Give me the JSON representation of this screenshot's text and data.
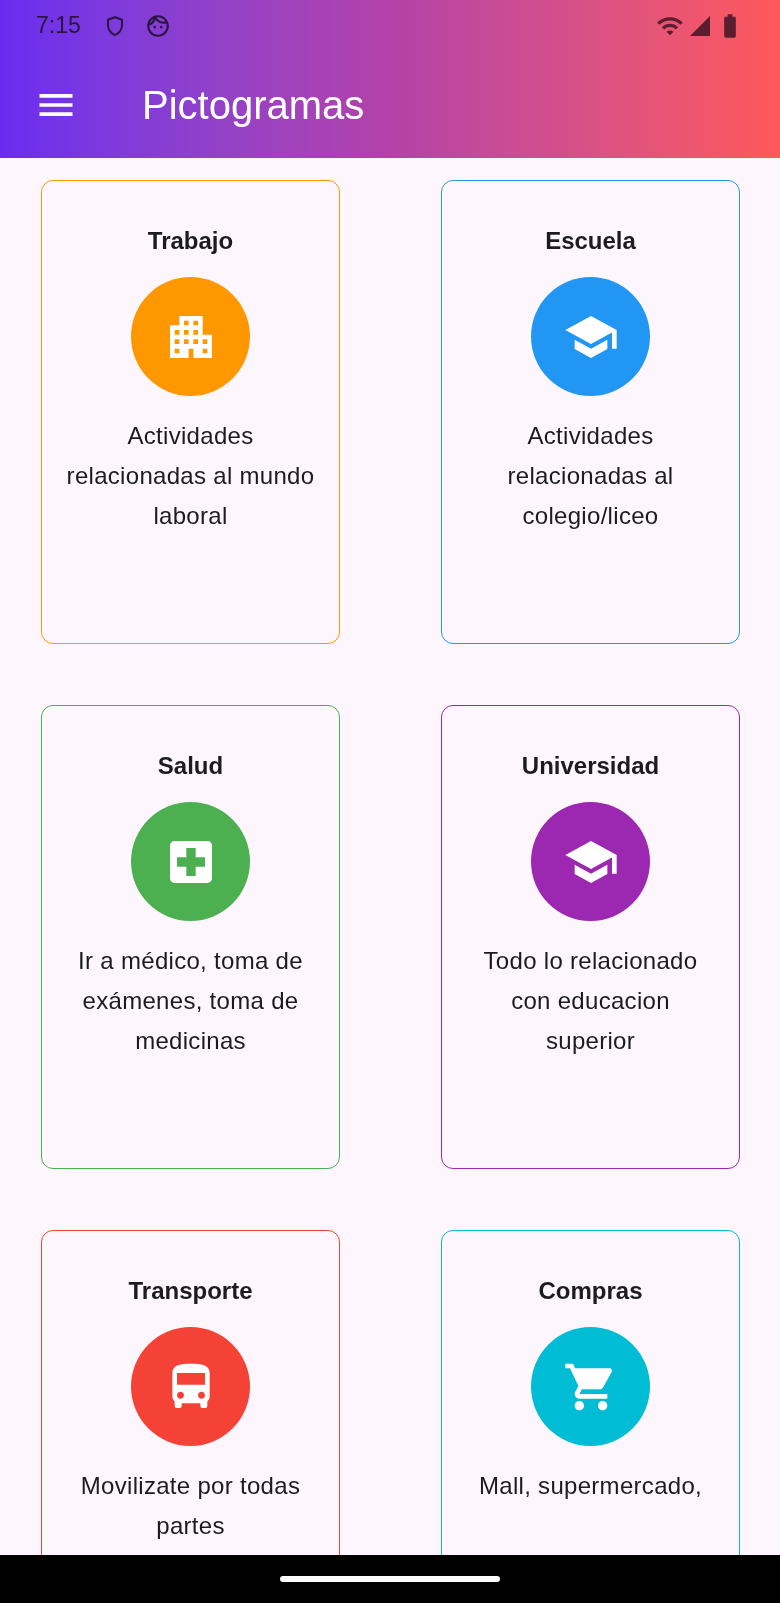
{
  "status_bar": {
    "time": "7:15"
  },
  "app_bar": {
    "title": "Pictogramas"
  },
  "categories": [
    {
      "kind": "work",
      "title": "Trabajo",
      "description": "Actividades relacionadas al mundo laboral",
      "color": "#ff9800"
    },
    {
      "kind": "school",
      "title": "Escuela",
      "description": "Actividades relacionadas al colegio/liceo",
      "color": "#2196f3"
    },
    {
      "kind": "health",
      "title": "Salud",
      "description": "Ir a médico, toma de exámenes, toma de medicinas",
      "color": "#4caf50"
    },
    {
      "kind": "school",
      "title": "Universidad",
      "description": "Todo lo relacionado con educacion superior",
      "color": "#9c27b0"
    },
    {
      "kind": "transport",
      "title": "Transporte",
      "description": "Movilizate por todas partes",
      "color": "#f44336"
    },
    {
      "kind": "shopping",
      "title": "Compras",
      "description": "Mall, supermercado,",
      "color": "#00bcd4"
    }
  ]
}
